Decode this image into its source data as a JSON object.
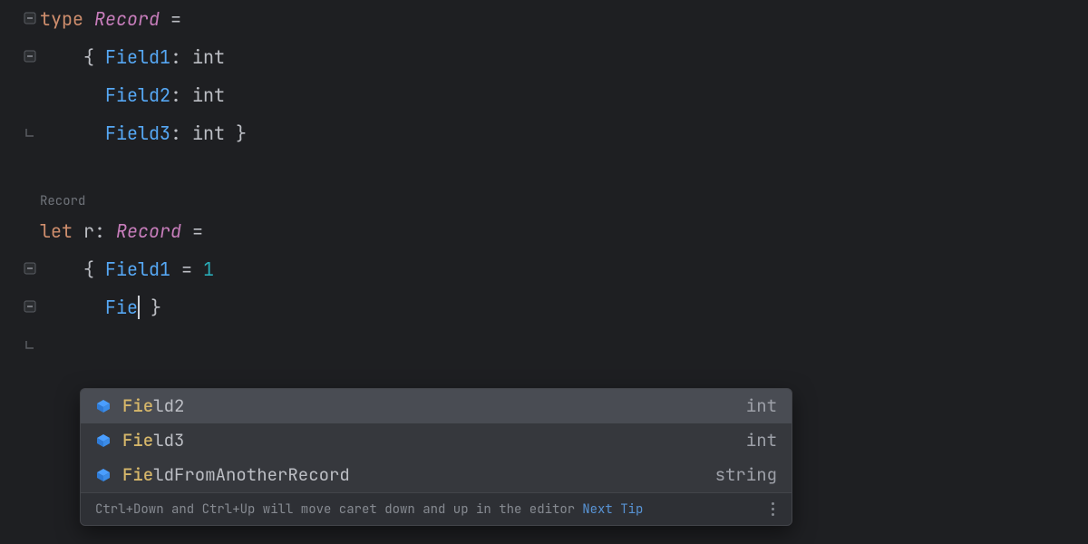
{
  "code": {
    "line1": {
      "kw": "type",
      "name": "Record ",
      "eq": "="
    },
    "line2": {
      "brace": "{ ",
      "field": "Field1",
      "colon": ": ",
      "type": "int"
    },
    "line3": {
      "field": "Field2",
      "colon": ": ",
      "type": "int"
    },
    "line4": {
      "field": "Field3",
      "colon": ": ",
      "type": "int",
      "brace": " }"
    },
    "hint": "Record",
    "line6": {
      "kw": "let",
      "name": " r",
      "colon": ": ",
      "typename": "Record ",
      "eq": "="
    },
    "line7": {
      "brace": "{ ",
      "field": "Field1",
      "eq": " = ",
      "val": "1"
    },
    "line8": {
      "typed": "Fie",
      "brace": " }"
    }
  },
  "completion": {
    "items": [
      {
        "match": "Fie",
        "rest": "ld2",
        "type": "int",
        "selected": true
      },
      {
        "match": "Fie",
        "rest": "ld3",
        "type": "int",
        "selected": false
      },
      {
        "match": "Fie",
        "rest": "ldFromAnotherRecord",
        "type": "string",
        "selected": false
      }
    ],
    "footer": {
      "tip": "Ctrl+Down and Ctrl+Up will move caret down and up in the editor",
      "next": "Next Tip"
    }
  }
}
